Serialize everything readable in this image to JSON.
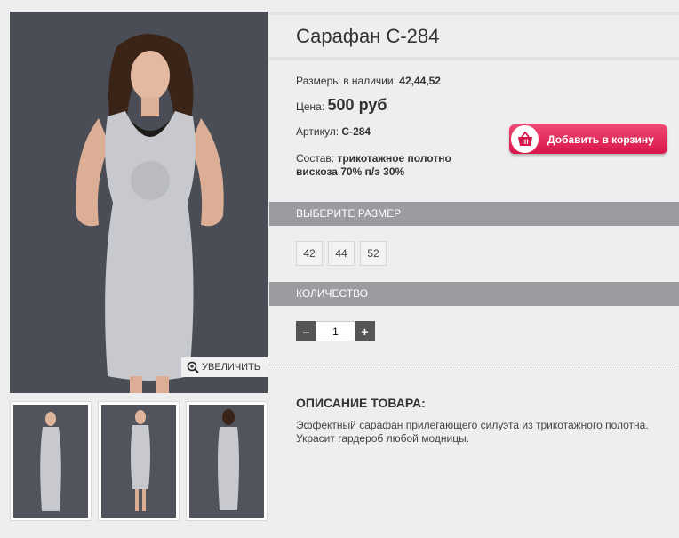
{
  "product": {
    "title": "Сарафан С-284",
    "sizes_label": "Размеры в наличии:",
    "sizes_value": "42,44,52",
    "price_label": "Цена:",
    "price_value": "500 руб",
    "article_label": "Артикул:",
    "article_value": "С-284",
    "composition_label": "Состав:",
    "composition_line1": "трикотажное полотно",
    "composition_line2": "вискоза 70% п/э 30%"
  },
  "cart_button": {
    "label": "Добавить в корзину",
    "icon": "basket-icon"
  },
  "gallery": {
    "zoom_label": "УВЕЛИЧИТЬ",
    "zoom_icon": "magnifier-icon"
  },
  "size_section": {
    "header": "ВЫБЕРИТЕ РАЗМЕР",
    "options": [
      "42",
      "44",
      "52"
    ]
  },
  "quantity_section": {
    "header": "КОЛИЧЕСТВО",
    "minus": "–",
    "plus": "+",
    "value": "1"
  },
  "description": {
    "heading": "ОПИСАНИЕ ТОВАРА:",
    "text": "Эффектный сарафан прилегающего силуэта из трикотажного полотна. Украсит гардероб любой модницы."
  },
  "colors": {
    "accent": "#d9144a",
    "section_bar": "#9a9ca0",
    "photo_bg": "#4a4d56"
  }
}
